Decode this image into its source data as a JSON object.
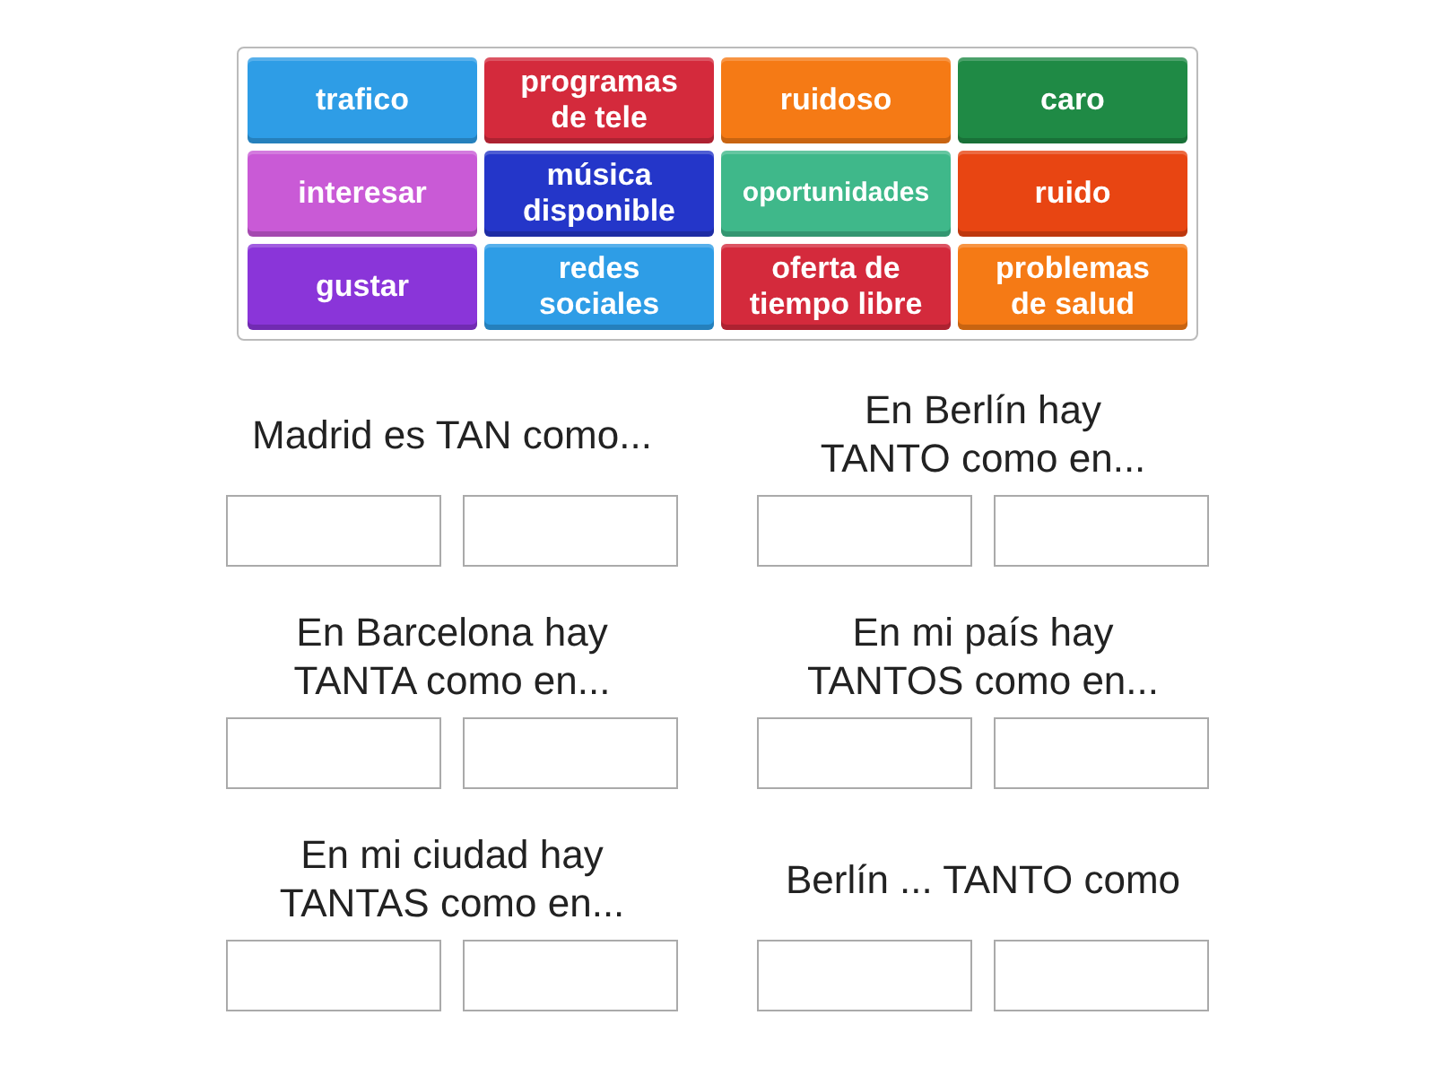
{
  "tiles": [
    {
      "label": "trafico",
      "color": "#2e9de6"
    },
    {
      "label": "programas de tele",
      "color": "#d42a3c"
    },
    {
      "label": "ruidoso",
      "color": "#f57a15"
    },
    {
      "label": "caro",
      "color": "#1f8a45"
    },
    {
      "label": "interesar",
      "color": "#c95ad6"
    },
    {
      "label": "música disponible",
      "color": "#2436c9"
    },
    {
      "label": "oportunidades",
      "color": "#3fb88a"
    },
    {
      "label": "ruido",
      "color": "#e84512"
    },
    {
      "label": "gustar",
      "color": "#8a35d9"
    },
    {
      "label": "redes sociales",
      "color": "#2e9de6"
    },
    {
      "label": "oferta de tiempo libre",
      "color": "#d42a3c"
    },
    {
      "label": "problemas de salud",
      "color": "#f57a15"
    }
  ],
  "group_rows": [
    [
      {
        "heading": [
          "Madrid es TAN como..."
        ]
      },
      {
        "heading": [
          "En Berlín hay",
          "TANTO como en..."
        ]
      }
    ],
    [
      {
        "heading": [
          "En Barcelona hay",
          "TANTA como en..."
        ]
      },
      {
        "heading": [
          "En mi país hay",
          "TANTOS como en..."
        ]
      }
    ],
    [
      {
        "heading": [
          "En mi ciudad hay",
          "TANTAS como en..."
        ]
      },
      {
        "heading": [
          "Berlín ... TANTO como"
        ]
      }
    ]
  ]
}
